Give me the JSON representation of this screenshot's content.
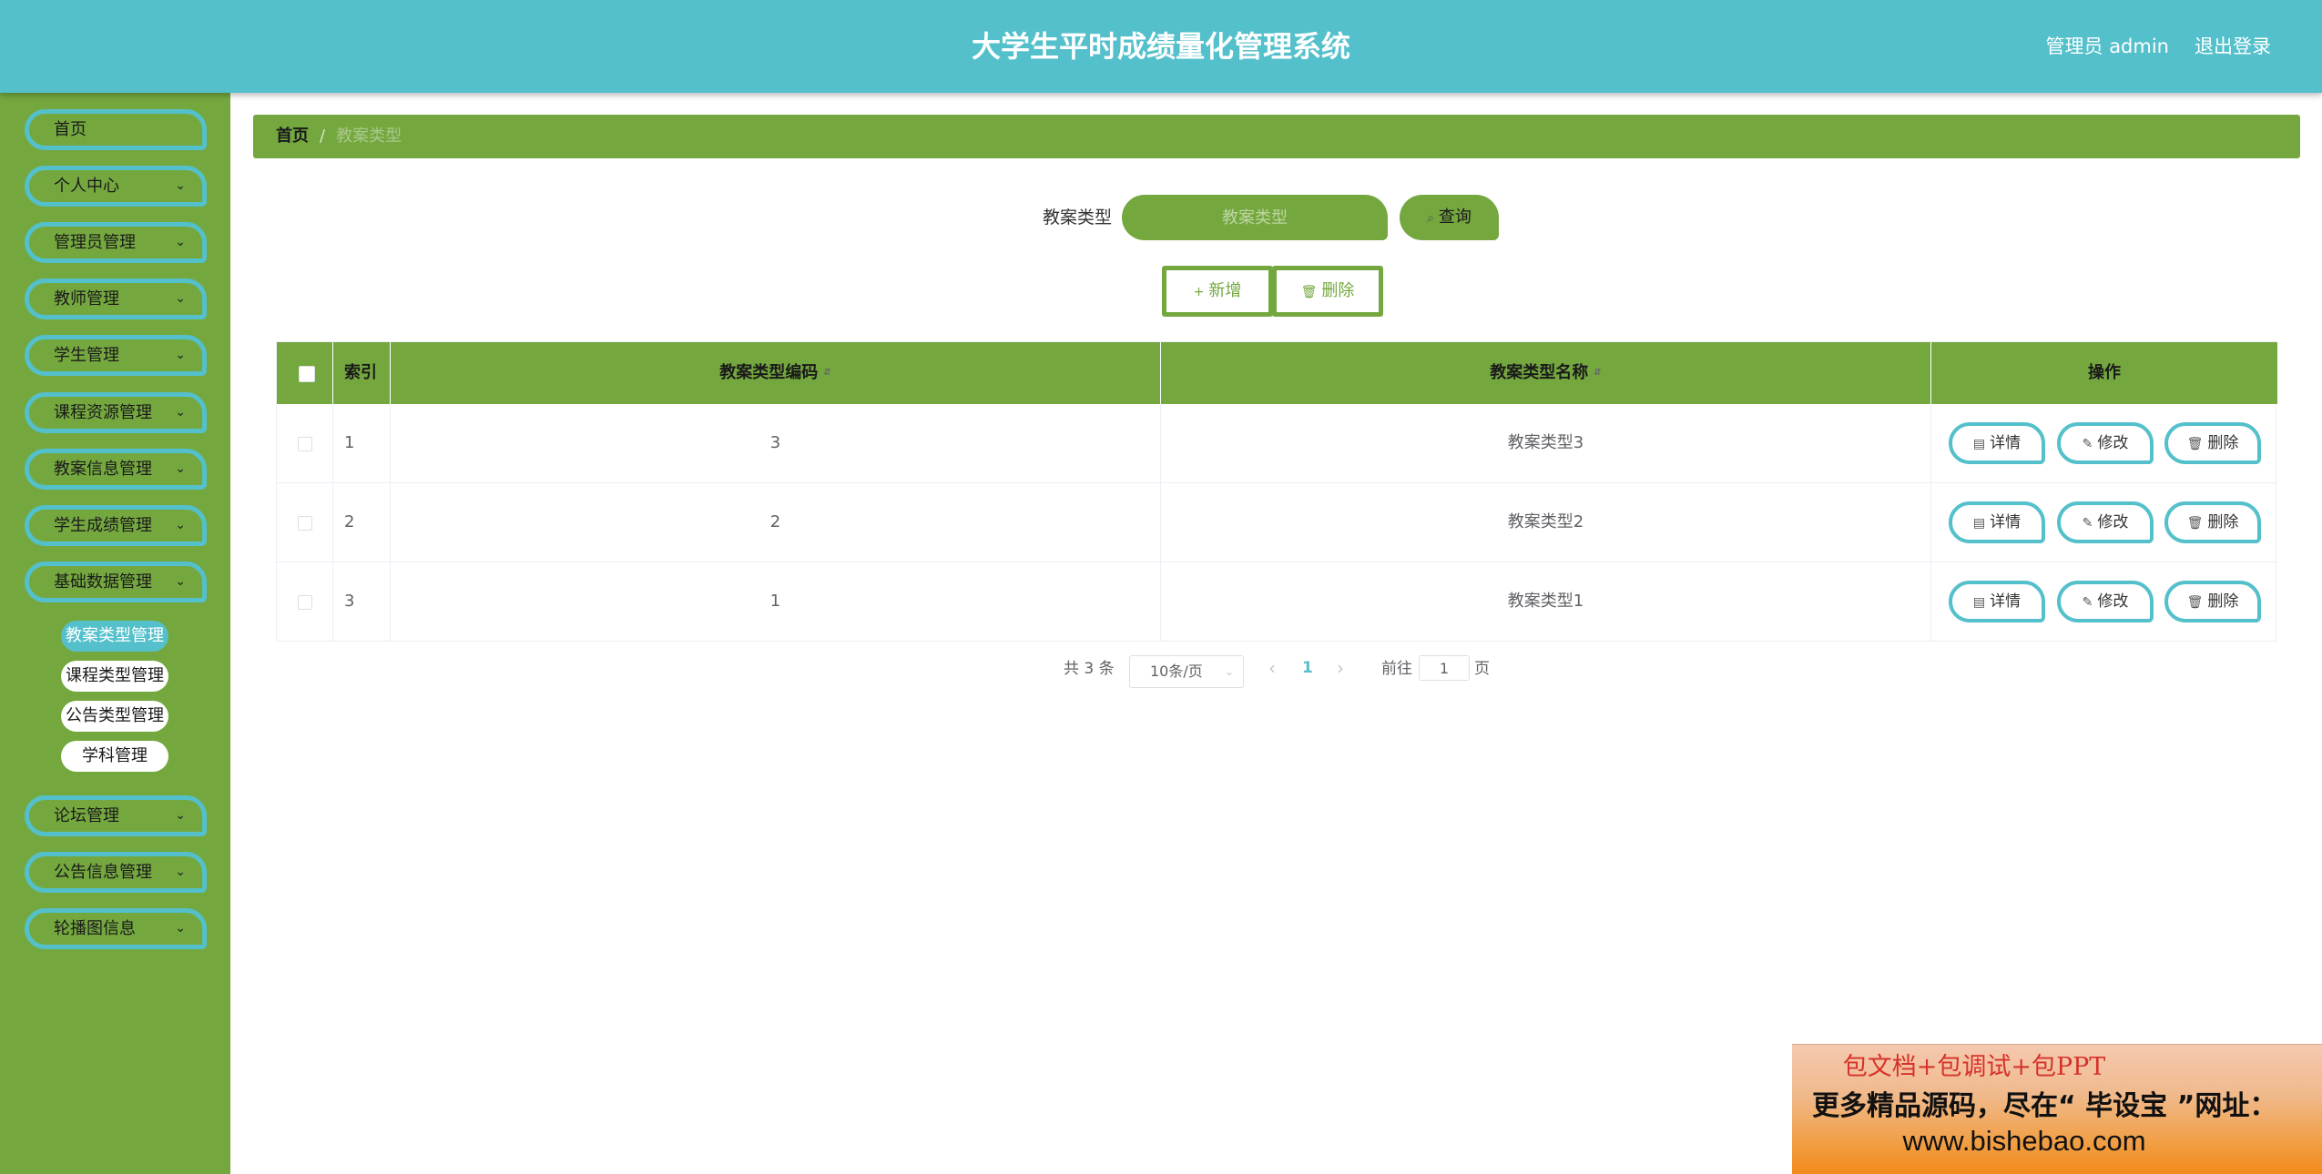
{
  "header": {
    "title": "大学生平时成绩量化管理系统",
    "user_label": "管理员 admin",
    "logout_label": "退出登录"
  },
  "sidebar": {
    "items": [
      {
        "label": "首页"
      },
      {
        "label": "个人中心"
      },
      {
        "label": "管理员管理"
      },
      {
        "label": "教师管理"
      },
      {
        "label": "学生管理"
      },
      {
        "label": "课程资源管理"
      },
      {
        "label": "教案信息管理"
      },
      {
        "label": "学生成绩管理"
      },
      {
        "label": "基础数据管理"
      },
      {
        "label": "论坛管理"
      },
      {
        "label": "公告信息管理"
      },
      {
        "label": "轮播图信息"
      }
    ],
    "sub_items": [
      {
        "label": "教案类型管理"
      },
      {
        "label": "课程类型管理"
      },
      {
        "label": "公告类型管理"
      },
      {
        "label": "学科管理"
      }
    ]
  },
  "breadcrumb": {
    "home": "首页",
    "separator": "/",
    "current": "教案类型"
  },
  "search": {
    "label": "教案类型",
    "placeholder": "教案类型",
    "button_label": "查询"
  },
  "actions": {
    "add_label": "新增",
    "delete_label": "删除"
  },
  "table": {
    "columns": {
      "index": "索引",
      "code": "教案类型编码",
      "name": "教案类型名称",
      "ops": "操作"
    },
    "rows": [
      {
        "index": "1",
        "code": "3",
        "name": "教案类型3"
      },
      {
        "index": "2",
        "code": "2",
        "name": "教案类型2"
      },
      {
        "index": "3",
        "code": "1",
        "name": "教案类型1"
      }
    ],
    "op_labels": {
      "detail": "详情",
      "edit": "修改",
      "delete": "删除"
    }
  },
  "pagination": {
    "total": "共 3 条",
    "page_size": "10条/页",
    "current_page": "1",
    "goto_label": "前往",
    "goto_value": "1",
    "page_unit": "页"
  },
  "ad": {
    "line1": "包文档+包调试+包PPT",
    "line2": "更多精品源码，尽在“ 毕设宝 ”网址：",
    "line3": "www.bishebao.com"
  },
  "colors": {
    "header": "#54c0cb",
    "sidebar": "#74a83f",
    "accent_border": "#54c0cb"
  }
}
